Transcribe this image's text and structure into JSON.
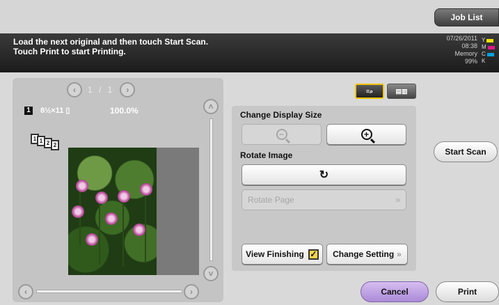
{
  "header": {
    "job_list_label": "Job List"
  },
  "message": {
    "text": "Load the next original and then touch Start Scan.\nTouch Print to start Printing."
  },
  "status": {
    "date": "07/26/2011",
    "time": "08:38",
    "memory_label": "Memory",
    "memory_value": "99%",
    "toner": [
      {
        "label": "Y",
        "color": "#f4e200"
      },
      {
        "label": "M",
        "color": "#e0188c"
      },
      {
        "label": "C",
        "color": "#00a0e0"
      },
      {
        "label": "K",
        "color": "#222222"
      }
    ]
  },
  "preview": {
    "page_indicator": "1  /  1",
    "copy_number": "1",
    "zoom_level": "100.0%",
    "page_thumbs": [
      "1",
      "1",
      "2",
      "2"
    ]
  },
  "view_modes": {
    "a_icon": "preview-mode-icon",
    "b_icon": "finishing-mode-icon"
  },
  "controls": {
    "change_display_size_label": "Change Display Size",
    "rotate_image_label": "Rotate Image",
    "rotate_page_label": "Rotate Page",
    "view_finishing_label": "View Finishing",
    "change_setting_label": "Change Setting"
  },
  "actions": {
    "start_scan_label": "Start Scan",
    "cancel_label": "Cancel",
    "print_label": "Print"
  }
}
